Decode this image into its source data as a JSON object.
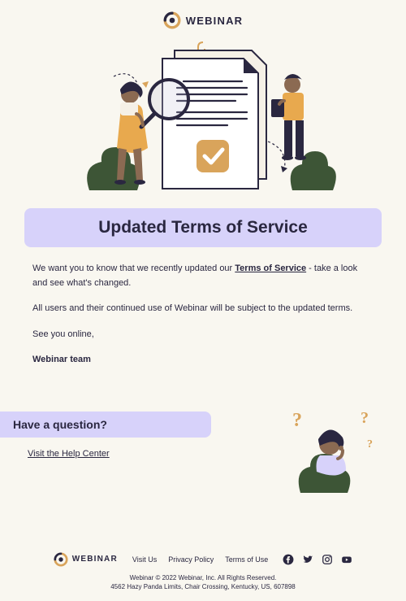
{
  "brand": {
    "name": "WEBINAR"
  },
  "title": "Updated Terms of Service",
  "body": {
    "p1_pre": "We want you to know that we recently updated our ",
    "tos_link": "Terms of Service",
    "p1_post": " - take a look and see what's changed.",
    "p2": "All users and their continued use of Webinar will be subject to the updated terms.",
    "p3": "See you online,",
    "signoff": "Webinar team"
  },
  "question": {
    "heading": "Have a question?",
    "help_link": "Visit the Help Center"
  },
  "footer": {
    "links": {
      "visit": "Visit Us",
      "privacy": "Privacy Policy",
      "terms": "Terms of Use"
    },
    "legal1": "Webinar © 2022 Webinar, Inc. All Rights Reserved.",
    "legal2": "4562 Hazy Panda Limits, Chair Crossing, Kentucky, US, 607898"
  }
}
